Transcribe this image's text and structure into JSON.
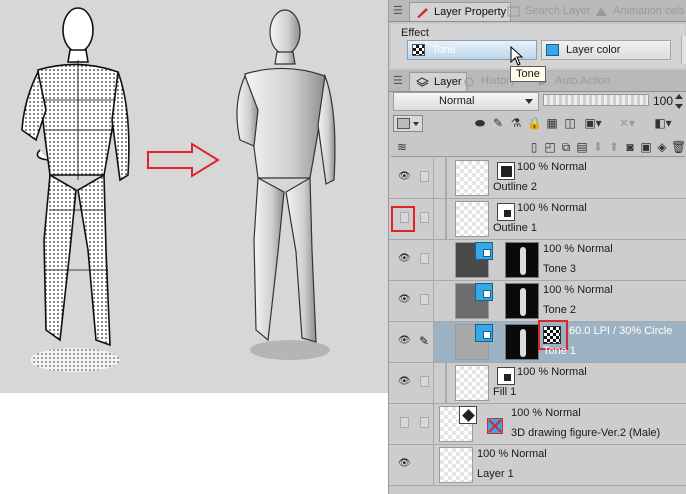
{
  "tabs_top": [
    {
      "label": "Layer Property",
      "active": true
    },
    {
      "label": "Search Layer",
      "active": false
    },
    {
      "label": "Animation cels",
      "active": false
    }
  ],
  "effect": {
    "title": "Effect",
    "tone_label": "Tone",
    "layer_color_label": "Layer color",
    "tooltip": "Tone"
  },
  "tabs_layer": [
    {
      "label": "Layer",
      "active": true
    },
    {
      "label": "History",
      "active": false
    },
    {
      "label": "Auto Action",
      "active": false
    }
  ],
  "blend_mode": "Normal",
  "opacity_value": "100",
  "layers": [
    {
      "name": "Outline 2",
      "status": "100 % Normal",
      "visible": true
    },
    {
      "name": "Outline 1",
      "status": "100 % Normal",
      "visible": false
    },
    {
      "name": "Tone 3",
      "status": "100 % Normal",
      "visible": true
    },
    {
      "name": "Tone 2",
      "status": "100 % Normal",
      "visible": true
    },
    {
      "name": "Tone 1",
      "status": "60.0 LPI / 30% Circle",
      "visible": true,
      "selected": true
    },
    {
      "name": "Fill 1",
      "status": "100 % Normal",
      "visible": true
    },
    {
      "name": "3D drawing figure-Ver.2 (Male)",
      "status": "100 % Normal",
      "visible": false
    },
    {
      "name": "Layer 1",
      "status": "100 % Normal",
      "visible": true
    }
  ],
  "colors": {
    "accent_red": "#e0242c",
    "tone_blue": "#35a8e8",
    "selected_row": "#9db3c4"
  }
}
